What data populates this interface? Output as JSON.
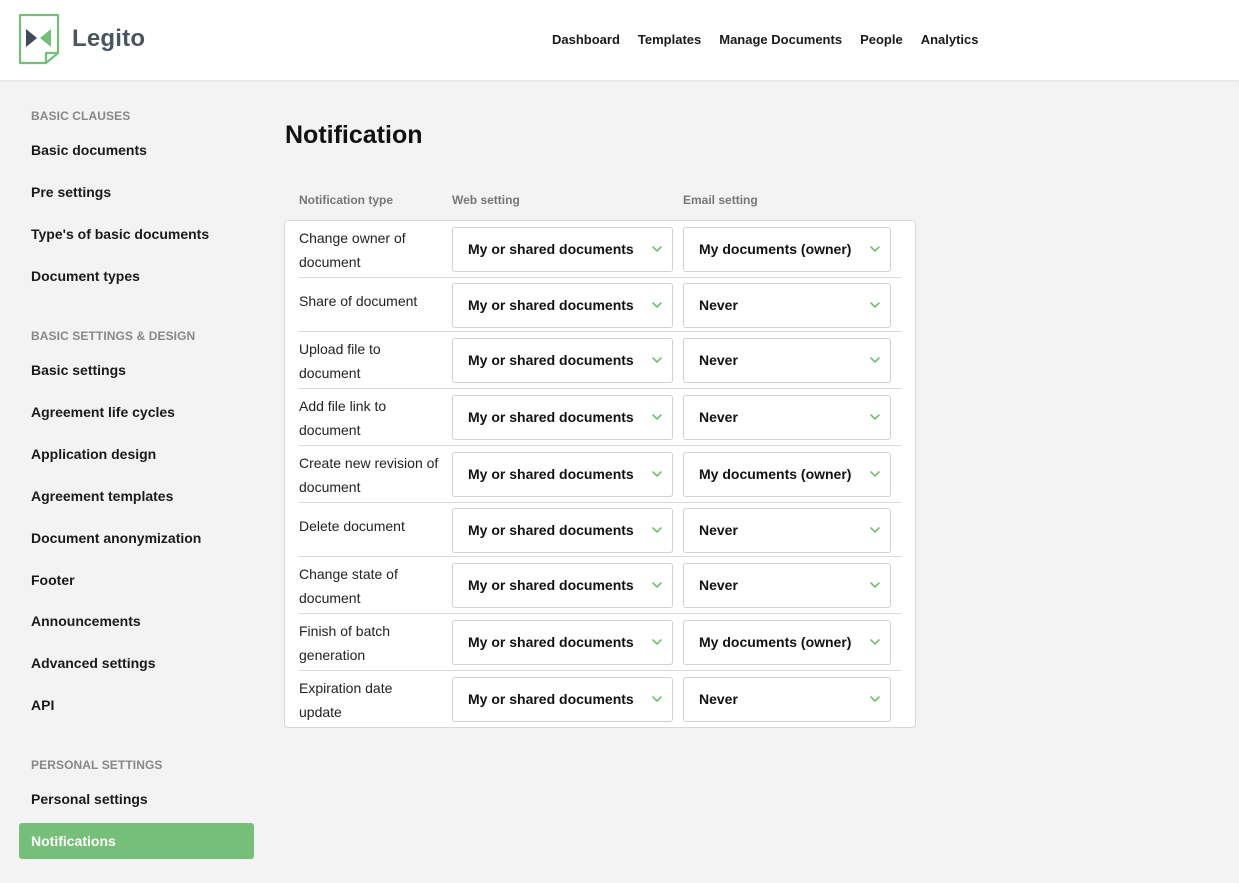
{
  "brand": {
    "name": "Legito",
    "accent": "#76bf79"
  },
  "nav": [
    "Dashboard",
    "Templates",
    "Manage Documents",
    "People",
    "Analytics"
  ],
  "sidebar": {
    "sections": [
      {
        "title": "BASIC CLAUSES",
        "items": [
          "Basic documents",
          "Pre settings",
          "Type's of basic documents",
          "Document types"
        ]
      },
      {
        "title": "BASIC SETTINGS & DESIGN",
        "items": [
          "Basic settings",
          "Agreement life cycles",
          "Application design",
          "Agreement templates",
          "Document anonymization",
          "Footer",
          "Announcements",
          "Advanced settings",
          "API"
        ]
      },
      {
        "title": "PERSONAL SETTINGS",
        "items": [
          "Personal settings",
          "Notifications"
        ]
      }
    ],
    "active": "Notifications"
  },
  "page": {
    "title": "Notification"
  },
  "table": {
    "headers": [
      "Notification type",
      "Web setting",
      "Email setting"
    ],
    "rows": [
      {
        "type": "Change owner of document",
        "web": "My or shared documents",
        "email": "My documents (owner)"
      },
      {
        "type": "Share of document",
        "web": "My or shared documents",
        "email": "Never"
      },
      {
        "type": "Upload file to document",
        "web": "My or shared documents",
        "email": "Never"
      },
      {
        "type": "Add file link to document",
        "web": "My or shared documents",
        "email": "Never"
      },
      {
        "type": "Create new revision of document",
        "web": "My or shared documents",
        "email": "My documents (owner)"
      },
      {
        "type": "Delete document",
        "web": "My or shared documents",
        "email": "Never"
      },
      {
        "type": "Change state of document",
        "web": "My or shared documents",
        "email": "Never"
      },
      {
        "type": "Finish of batch generation",
        "web": "My or shared documents",
        "email": "My documents (owner)"
      },
      {
        "type": "Expiration date update",
        "web": "My or shared documents",
        "email": "Never"
      }
    ]
  },
  "icons": {
    "dropdown": "chevron-down-icon",
    "logo": "legito-logo-icon"
  }
}
